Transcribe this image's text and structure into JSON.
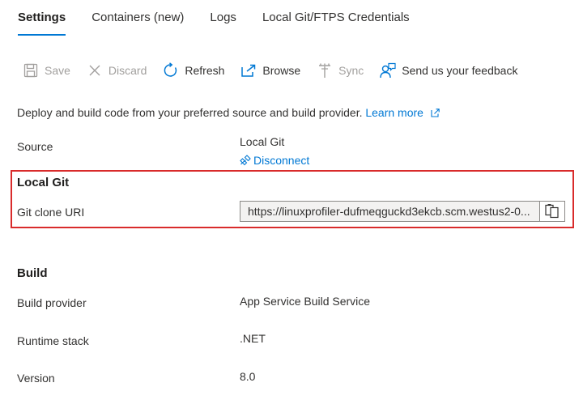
{
  "tabs": [
    {
      "label": "Settings",
      "active": true
    },
    {
      "label": "Containers (new)",
      "active": false
    },
    {
      "label": "Logs",
      "active": false
    },
    {
      "label": "Local Git/FTPS Credentials",
      "active": false
    }
  ],
  "toolbar": {
    "save": "Save",
    "discard": "Discard",
    "refresh": "Refresh",
    "browse": "Browse",
    "sync": "Sync",
    "feedback": "Send us your feedback"
  },
  "description": {
    "text": "Deploy and build code from your preferred source and build provider.",
    "learn_more": "Learn more"
  },
  "source": {
    "label": "Source",
    "value": "Local Git",
    "disconnect": "Disconnect"
  },
  "local_git": {
    "title": "Local Git",
    "clone_uri_label": "Git clone URI",
    "clone_uri_value": "https://linuxprofiler-dufmeqguckd3ekcb.scm.westus2-0..."
  },
  "build": {
    "title": "Build",
    "provider_label": "Build provider",
    "provider_value": "App Service Build Service",
    "runtime_label": "Runtime stack",
    "runtime_value": ".NET",
    "version_label": "Version",
    "version_value": "8.0"
  },
  "colors": {
    "accent": "#0078d4",
    "highlight_border": "#d92b2b",
    "disabled_text": "#a19f9d"
  },
  "icons": {
    "save": "save-icon",
    "discard": "close-icon",
    "refresh": "refresh-icon",
    "browse": "open-external-icon",
    "sync": "sync-icon",
    "feedback": "feedback-person-icon",
    "learn_more": "external-link-icon",
    "disconnect": "disconnect-plug-icon",
    "copy": "copy-icon"
  }
}
